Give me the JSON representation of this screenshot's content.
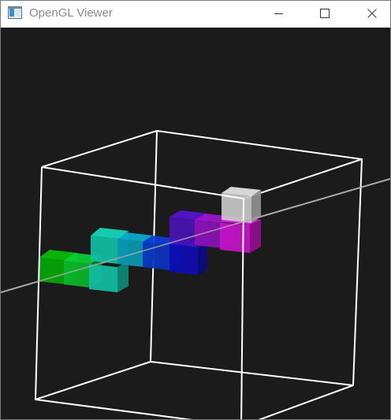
{
  "window": {
    "title": "OpenGL Viewer",
    "icon": "window-app-icon",
    "controls": {
      "minimize": "minimize-icon",
      "maximize": "maximize-icon",
      "close": "close-icon"
    }
  },
  "viewport": {
    "background": "#1b1b1b",
    "bounding_box_color": "#ffffff",
    "axis_line_color": "#a9a9a9",
    "cubes": [
      {
        "color": "#05a606"
      },
      {
        "color": "#09b62c"
      },
      {
        "color": "#11bfa4"
      },
      {
        "color": "#0997b2"
      },
      {
        "color": "#0a34c0"
      },
      {
        "color": "#0d0db2"
      },
      {
        "color": "#4a12b4"
      },
      {
        "color": "#8a12b4"
      },
      {
        "color": "#c414c8"
      },
      {
        "color": "#c8c8c8"
      }
    ]
  }
}
